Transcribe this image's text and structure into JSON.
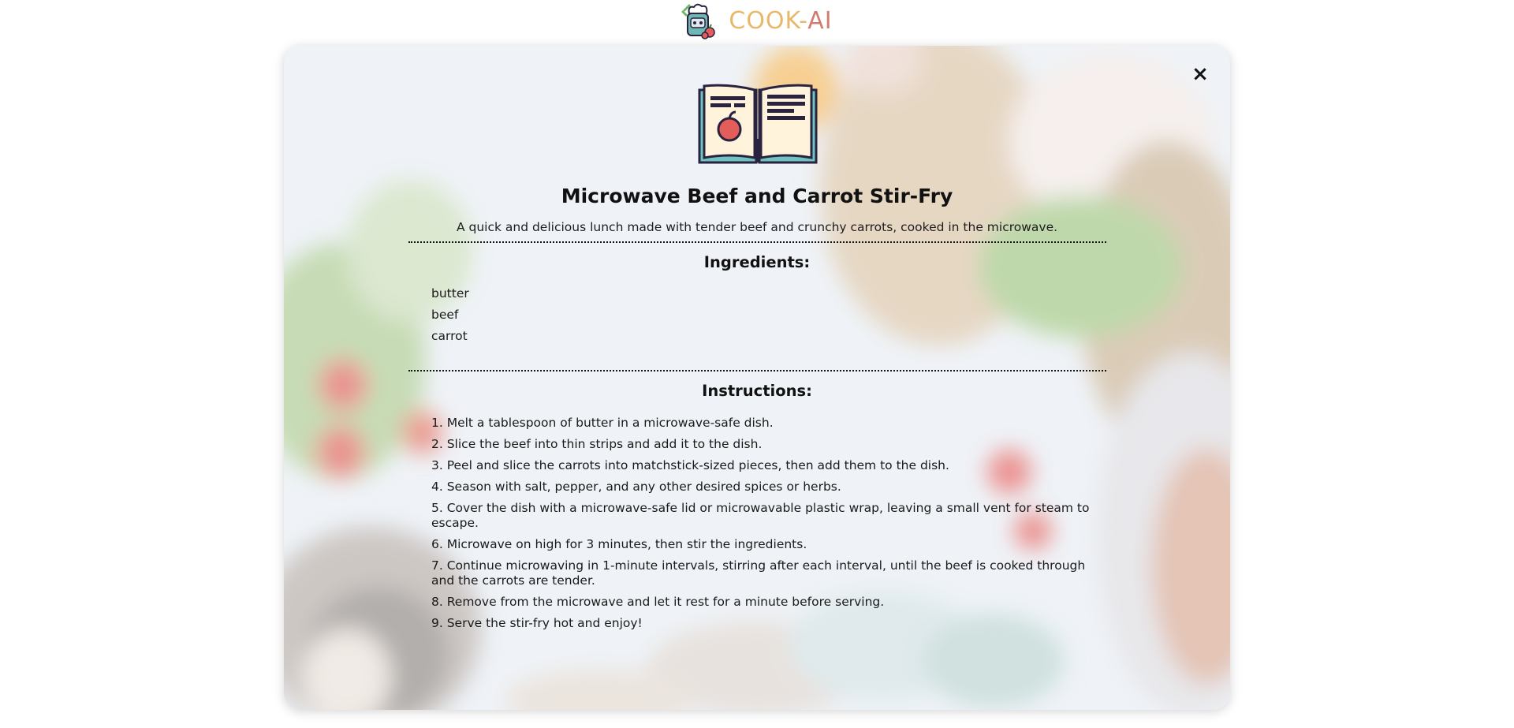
{
  "header": {
    "brand_part1": "COOK-",
    "brand_part2": "AI",
    "logo_icon": "chef-robot-icon",
    "colors": {
      "brand_primary": "#e8b86a",
      "brand_secondary": "#d07c6f"
    }
  },
  "modal": {
    "close_label": "×",
    "icon": "recipe-book-icon",
    "title": "Microwave Beef and Carrot Stir-Fry",
    "description": "A quick and delicious lunch made with tender beef and crunchy carrots, cooked in the microwave.",
    "ingredients_heading": "Ingredients:",
    "ingredients": [
      "butter",
      "beef",
      "carrot"
    ],
    "instructions_heading": "Instructions:",
    "instructions": [
      "1. Melt a tablespoon of butter in a microwave-safe dish.",
      "2. Slice the beef into thin strips and add it to the dish.",
      "3. Peel and slice the carrots into matchstick-sized pieces, then add them to the dish.",
      "4. Season with salt, pepper, and any other desired spices or herbs.",
      "5. Cover the dish with a microwave-safe lid or microwavable plastic wrap, leaving a small vent for steam to escape.",
      "6. Microwave on high for 3 minutes, then stir the ingredients.",
      "7. Continue microwaving in 1-minute intervals, stirring after each interval, until the beef is cooked through and the carrots are tender.",
      "8. Remove from the microwave and let it rest for a minute before serving.",
      "9. Serve the stir-fry hot and enjoy!"
    ]
  }
}
